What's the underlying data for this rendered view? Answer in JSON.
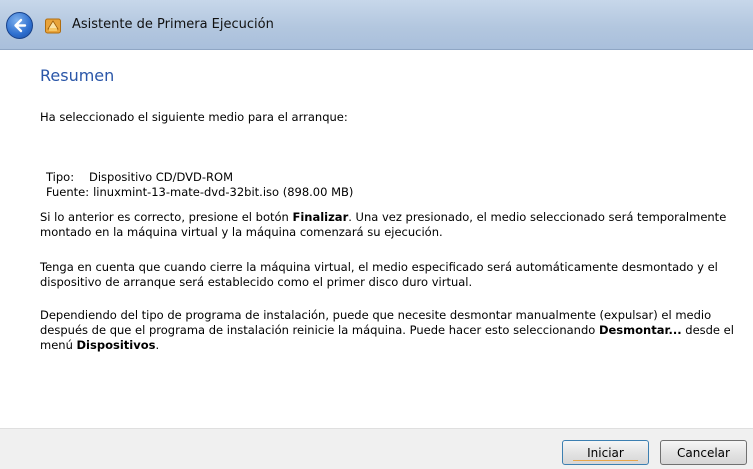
{
  "window": {
    "title": "Asistente de Primera Ejecución"
  },
  "colors": {
    "heading": "#2a56a8",
    "titlebar": "#b3c7df"
  },
  "content": {
    "heading": "Resumen",
    "intro": "Ha seleccionado el siguiente medio para el arranque:",
    "tipo_label": "Tipo:",
    "tipo_value": "Dispositivo CD/DVD-ROM",
    "fuente_label": "Fuente:",
    "fuente_value": "linuxmint-13-mate-dvd-32bit.iso (898.00 MB)",
    "p1_a": "Si lo anterior es correcto, presione el botón ",
    "p1_bold": "Finalizar",
    "p1_b": ". Una vez presionado, el medio seleccionado será temporalmente",
    "p1_line2": "montado en la máquina virtual y la máquina comenzará su ejecución.",
    "p2_line1": "Tenga en cuenta que cuando cierre la máquina virtual, el medio especificado será automáticamente desmontado y el",
    "p2_line2": "dispositivo de arranque será establecido como el primer disco duro virtual.",
    "p3_line1": "Dependiendo del tipo de programa de instalación, puede que necesite desmontar manualmente (expulsar) el medio",
    "p3_line2a": "después de que el programa de instalación reinicie la máquina. Puede hacer esto seleccionando ",
    "p3_bold1": "Desmontar...",
    "p3_line2b": " desde el",
    "p3_line3a": "menú ",
    "p3_bold2": "Dispositivos",
    "p3_line3b": "."
  },
  "buttons": {
    "start": "Iniciar",
    "cancel": "Cancelar"
  }
}
